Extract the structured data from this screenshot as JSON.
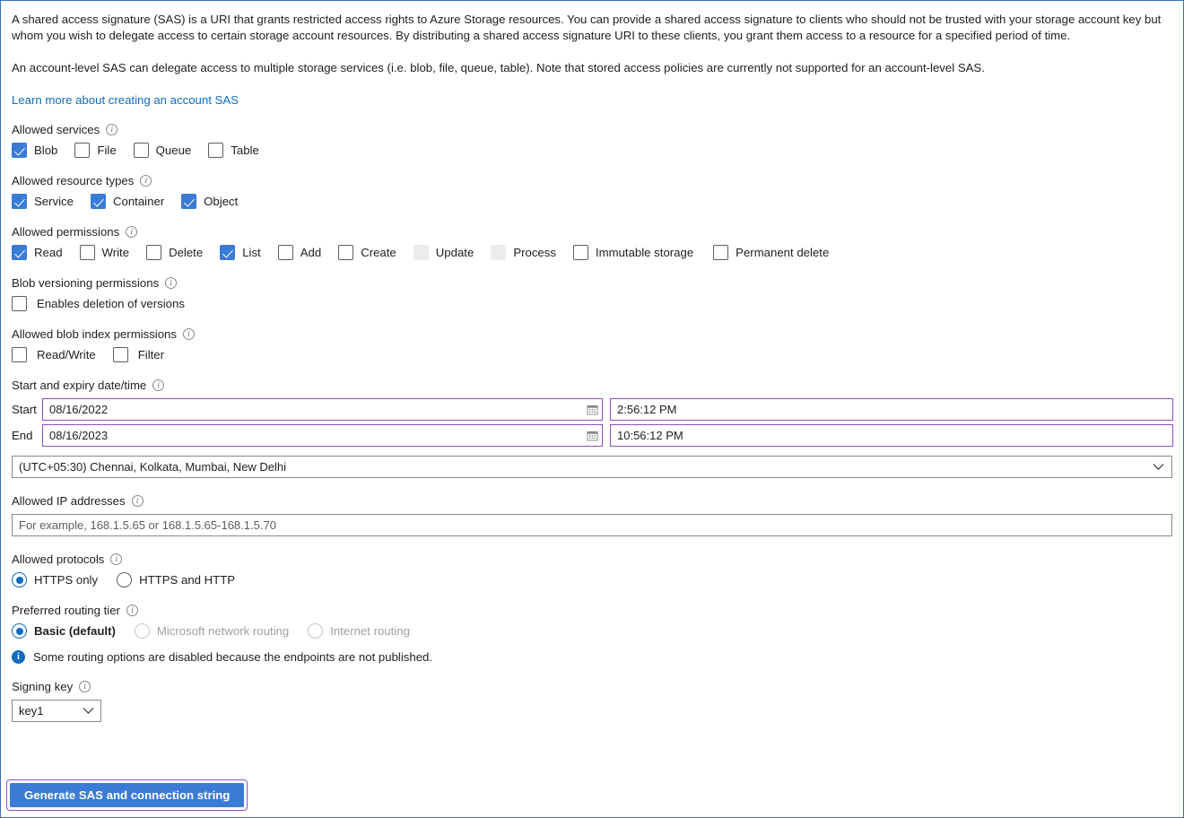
{
  "intro": {
    "paragraph1": "A shared access signature (SAS) is a URI that grants restricted access rights to Azure Storage resources. You can provide a shared access signature to clients who should not be trusted with your storage account key but whom you wish to delegate access to certain storage account resources. By distributing a shared access signature URI to these clients, you grant them access to a resource for a specified period of time.",
    "paragraph2": "An account-level SAS can delegate access to multiple storage services (i.e. blob, file, queue, table). Note that stored access policies are currently not supported for an account-level SAS.",
    "learn_more": "Learn more about creating an account SAS"
  },
  "allowed_services": {
    "label": "Allowed services",
    "items": [
      {
        "label": "Blob",
        "checked": true,
        "disabled": false
      },
      {
        "label": "File",
        "checked": false,
        "disabled": false
      },
      {
        "label": "Queue",
        "checked": false,
        "disabled": false
      },
      {
        "label": "Table",
        "checked": false,
        "disabled": false
      }
    ]
  },
  "allowed_resource_types": {
    "label": "Allowed resource types",
    "items": [
      {
        "label": "Service",
        "checked": true,
        "disabled": false
      },
      {
        "label": "Container",
        "checked": true,
        "disabled": false
      },
      {
        "label": "Object",
        "checked": true,
        "disabled": false
      }
    ]
  },
  "allowed_permissions": {
    "label": "Allowed permissions",
    "items": [
      {
        "label": "Read",
        "checked": true,
        "disabled": false
      },
      {
        "label": "Write",
        "checked": false,
        "disabled": false
      },
      {
        "label": "Delete",
        "checked": false,
        "disabled": false
      },
      {
        "label": "List",
        "checked": true,
        "disabled": false
      },
      {
        "label": "Add",
        "checked": false,
        "disabled": false
      },
      {
        "label": "Create",
        "checked": false,
        "disabled": false
      },
      {
        "label": "Update",
        "checked": false,
        "disabled": true
      },
      {
        "label": "Process",
        "checked": false,
        "disabled": true
      },
      {
        "label": "Immutable storage",
        "checked": false,
        "disabled": false
      },
      {
        "label": "Permanent delete",
        "checked": false,
        "disabled": false
      }
    ]
  },
  "blob_versioning_permissions": {
    "label": "Blob versioning permissions",
    "items": [
      {
        "label": "Enables deletion of versions",
        "checked": false,
        "disabled": false
      }
    ]
  },
  "allowed_blob_index_permissions": {
    "label": "Allowed blob index permissions",
    "items": [
      {
        "label": "Read/Write",
        "checked": false,
        "disabled": false
      },
      {
        "label": "Filter",
        "checked": false,
        "disabled": false
      }
    ]
  },
  "date_time": {
    "label": "Start and expiry date/time",
    "start_row_label": "Start",
    "end_row_label": "End",
    "start_date": "08/16/2022",
    "start_time": "2:56:12 PM",
    "end_date": "08/16/2023",
    "end_time": "10:56:12 PM",
    "timezone": "(UTC+05:30) Chennai, Kolkata, Mumbai, New Delhi"
  },
  "allowed_ip": {
    "label": "Allowed IP addresses",
    "placeholder": "For example, 168.1.5.65 or 168.1.5.65-168.1.5.70",
    "value": ""
  },
  "allowed_protocols": {
    "label": "Allowed protocols",
    "items": [
      {
        "label": "HTTPS only",
        "selected": true,
        "disabled": false
      },
      {
        "label": "HTTPS and HTTP",
        "selected": false,
        "disabled": false
      }
    ]
  },
  "preferred_routing_tier": {
    "label": "Preferred routing tier",
    "items": [
      {
        "label": "Basic (default)",
        "selected": true,
        "disabled": false
      },
      {
        "label": "Microsoft network routing",
        "selected": false,
        "disabled": true
      },
      {
        "label": "Internet routing",
        "selected": false,
        "disabled": true
      }
    ]
  },
  "routing_notice": {
    "text": "Some routing options are disabled because the endpoints are not published."
  },
  "signing_key": {
    "label": "Signing key",
    "value": "key1"
  },
  "generate_button": {
    "label": "Generate SAS and connection string"
  },
  "colors": {
    "accent_blue": "#3a7bd5",
    "link_blue": "#0f6cbd",
    "focus_purple": "#8e4ec6",
    "page_border": "#3b6bbf",
    "disabled_grey": "#a19f9d"
  }
}
